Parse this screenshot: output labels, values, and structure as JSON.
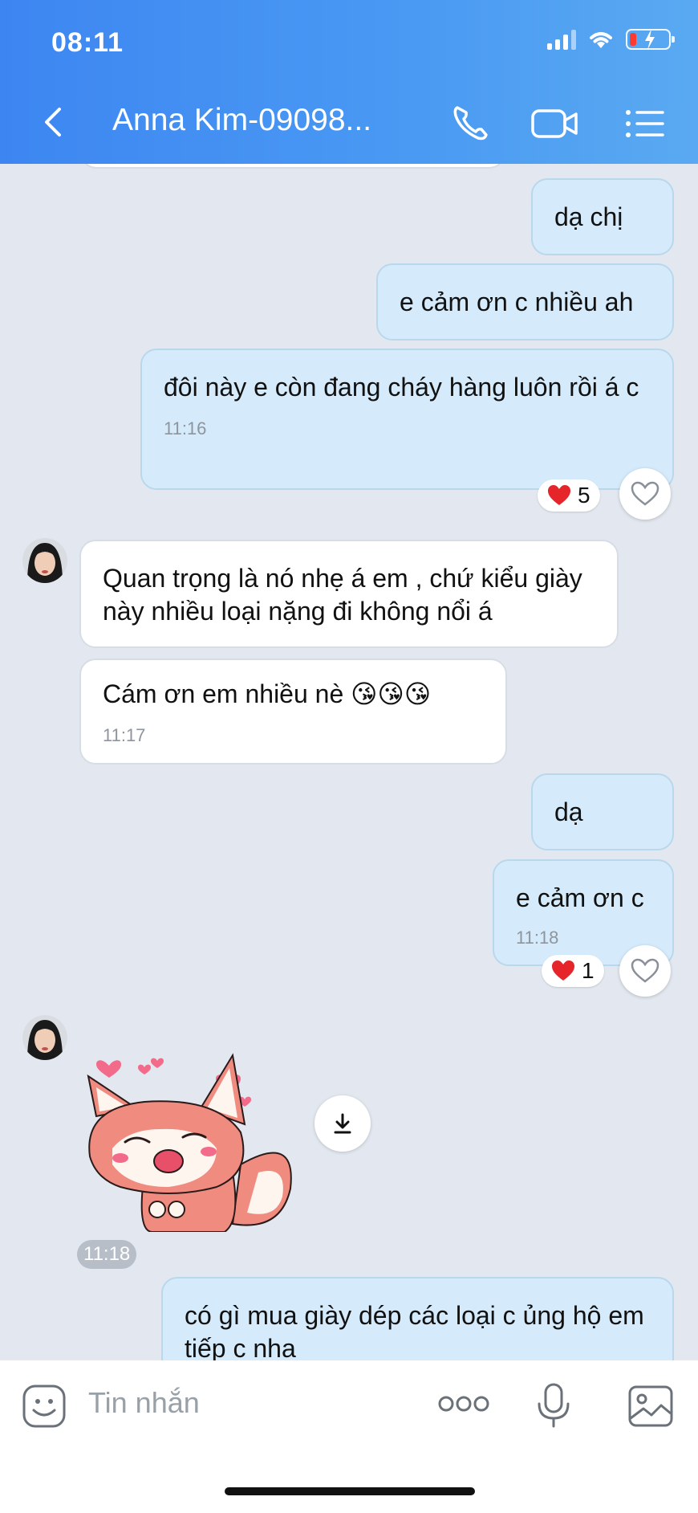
{
  "status_bar": {
    "time": "08:11"
  },
  "header": {
    "contact_name": "Anna Kim-09098..."
  },
  "messages": [
    {
      "text": "dạ chị"
    },
    {
      "text": "e cảm ơn c nhiều ah"
    },
    {
      "text": "đôi này e còn đang cháy hàng luôn rồi á c",
      "time": "11:16",
      "reaction_count": "5"
    },
    {
      "text": "Quan trọng là nó nhẹ á em , chứ kiểu giày này nhiều loại nặng đi không nổi á"
    },
    {
      "text": "Cám ơn em nhiều nè 😘😘😘",
      "time": "11:17"
    },
    {
      "text": "dạ"
    },
    {
      "text": "e cảm ơn c",
      "time": "11:18",
      "reaction_count": "1"
    },
    {
      "time": "11:18"
    },
    {
      "text": "có gì mua giày dép các loại c ủng hộ em tiếp c nha"
    }
  ],
  "composer": {
    "placeholder": "Tin nhắn"
  },
  "colors": {
    "header": "#3d86f2",
    "outgoing_bubble": "#d5ebfb",
    "incoming_bubble": "#ffffff",
    "chat_bg": "#e3e8f0"
  }
}
